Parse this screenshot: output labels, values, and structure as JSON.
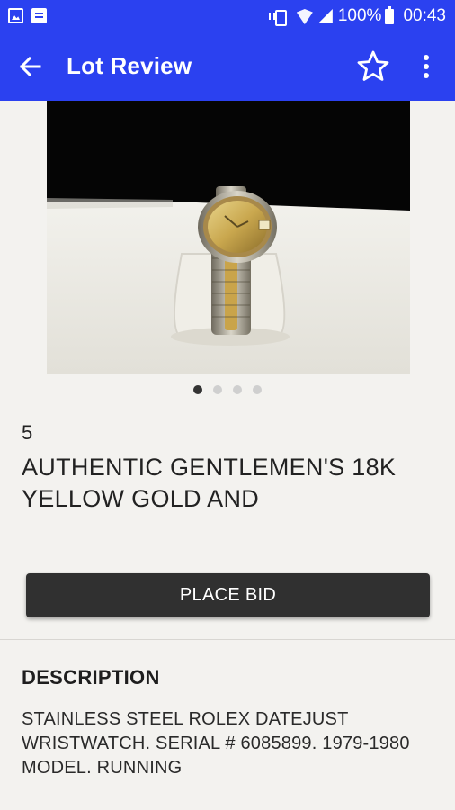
{
  "status_bar": {
    "battery": "100%",
    "time": "00:43",
    "icons": [
      "image-notification-icon",
      "app-notification-icon",
      "vibrate-icon",
      "wifi-icon",
      "signal-icon",
      "battery-icon"
    ]
  },
  "app_bar": {
    "title": "Lot Review",
    "back_icon": "arrow-back-icon",
    "favorite_icon": "star-outline-icon",
    "menu_icon": "more-vert-icon",
    "color": "#2b41f0"
  },
  "gallery": {
    "image": "gold-and-steel-wristwatch-photo",
    "page_count": 4,
    "active_index": 0
  },
  "lot": {
    "number": "5",
    "title": "AUTHENTIC GENTLEMEN'S 18K YELLOW GOLD AND"
  },
  "bid_button": {
    "label": "PLACE BID"
  },
  "description": {
    "heading": "DESCRIPTION",
    "body": "STAINLESS STEEL ROLEX DATEJUST WRISTWATCH. SERIAL # 6085899. 1979-1980 MODEL. RUNNING"
  }
}
